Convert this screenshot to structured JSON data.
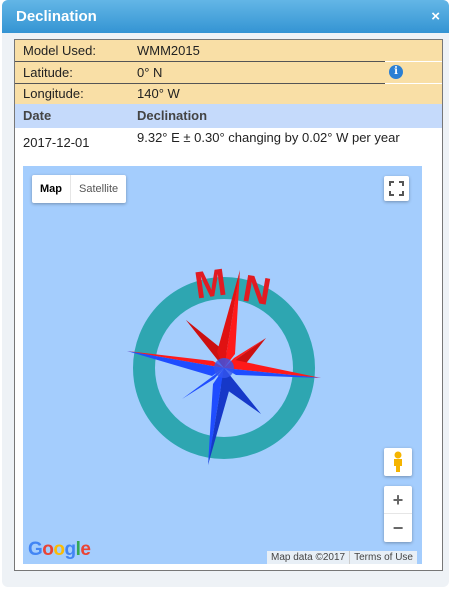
{
  "dialog": {
    "title": "Declination",
    "close_label": "×"
  },
  "info": {
    "model_label": "Model Used:",
    "model_value": "WMM2015",
    "latitude_label": "Latitude:",
    "latitude_value": "0° N",
    "longitude_label": "Longitude:",
    "longitude_value": "140° W",
    "info_icon_glyph": "i"
  },
  "table": {
    "headers": [
      "Date",
      "Declination"
    ],
    "rows": [
      {
        "date": "2017-12-01",
        "declination": "9.32° E  ± 0.30°  changing by  0.02° W per year"
      }
    ]
  },
  "map": {
    "type_buttons": [
      "Map",
      "Satellite"
    ],
    "active_type": "Map",
    "zoom_in_label": "+",
    "zoom_out_label": "−",
    "logo_text": "Google",
    "logo_colors": [
      "#4285F4",
      "#EA4335",
      "#FBBC05",
      "#4285F4",
      "#34A853",
      "#EA4335"
    ],
    "attribution": "Map data ©2017",
    "terms_label": "Terms of Use",
    "compass_labels": {
      "magnetic": "M",
      "true_north": "N"
    }
  },
  "colors": {
    "title_gradient_top": "#63b6e6",
    "title_gradient_bottom": "#3494d3",
    "info_bg": "#f9dfa6",
    "header_bg": "#c5dafb",
    "map_water": "#a4cdfd",
    "compass_ring": "#2ea6b1",
    "compass_red": "#ff1a1a",
    "compass_blue": "#1f4dff"
  }
}
